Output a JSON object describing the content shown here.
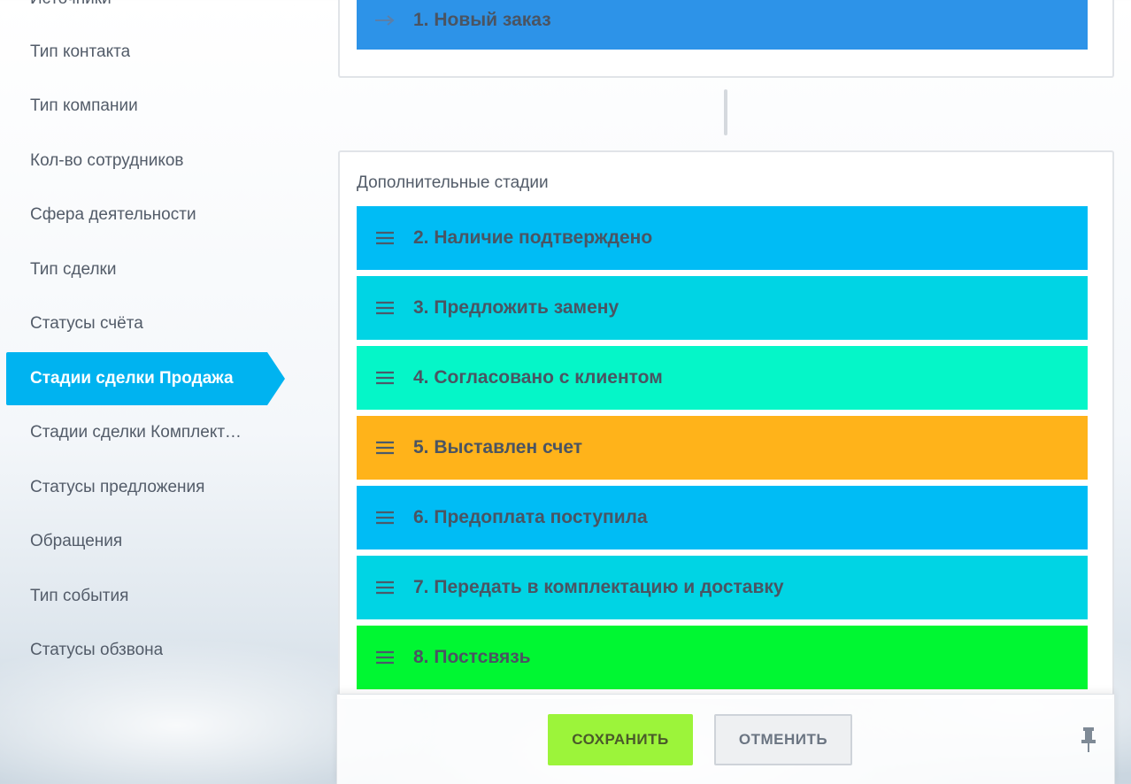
{
  "sidebar": {
    "top_cut_label": "Источники",
    "items": [
      {
        "label": "Тип контакта",
        "active": false
      },
      {
        "label": "Тип компании",
        "active": false
      },
      {
        "label": "Кол-во сотрудников",
        "active": false
      },
      {
        "label": "Сфера деятельности",
        "active": false
      },
      {
        "label": "Тип сделки",
        "active": false
      },
      {
        "label": "Статусы счёта",
        "active": false
      },
      {
        "label": "Стадии сделки Продажа",
        "active": true
      },
      {
        "label": "Стадии сделки Комплектация",
        "active": false
      },
      {
        "label": "Статусы предложения",
        "active": false
      },
      {
        "label": "Обращения",
        "active": false
      },
      {
        "label": "Тип события",
        "active": false
      },
      {
        "label": "Статусы обзвона",
        "active": false
      }
    ]
  },
  "first_stage": {
    "label": "1. Новый заказ",
    "color": "#2d93e8",
    "icon": "arrow-right-icon"
  },
  "extra_stages": {
    "title": "Дополнительные стадии",
    "items": [
      {
        "label": "2. Наличие подтверждено",
        "color": "#00bcf5"
      },
      {
        "label": "3. Предложить замену",
        "color": "#00d4e4"
      },
      {
        "label": "4. Согласовано с клиентом",
        "color": "#05f6c8"
      },
      {
        "label": "5. Выставлен счет",
        "color": "#ffb31a"
      },
      {
        "label": "6. Предоплата поступила",
        "color": "#00bcf5"
      },
      {
        "label": "7. Передать в комплектацию и доставку",
        "color": "#00d4e4"
      },
      {
        "label": "8. Постсвязь",
        "color": "#00f732"
      }
    ]
  },
  "footer": {
    "save_label": "СОХРАНИТЬ",
    "cancel_label": "ОТМЕНИТЬ",
    "pin_icon": "pin-icon"
  }
}
